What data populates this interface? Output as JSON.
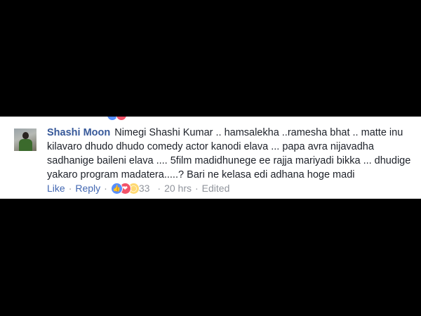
{
  "comment": {
    "author": "Shashi Moon",
    "text": "Nimegi Shashi Kumar .. hamsalekha ..ramesha bhat .. matte inu kilavaro dhudo dhudo comedy actor kanodi elava ... papa avra nijavadha sadhanige baileni elava .... 5film madidhunege ee rajja mariyadi bikka ... dhudige yakaro program madatera.....? Bari ne kelasa edi adhana hoge madi",
    "actions": {
      "like_label": "Like",
      "reply_label": "Reply",
      "reaction_count": "33",
      "time": "20 hrs",
      "edited_label": "Edited"
    },
    "reactions": [
      "like-icon",
      "love-icon",
      "wow-icon"
    ],
    "colors": {
      "author": "#365899",
      "link": "#4267b2",
      "meta": "#90949c",
      "text": "#1d2129"
    }
  }
}
